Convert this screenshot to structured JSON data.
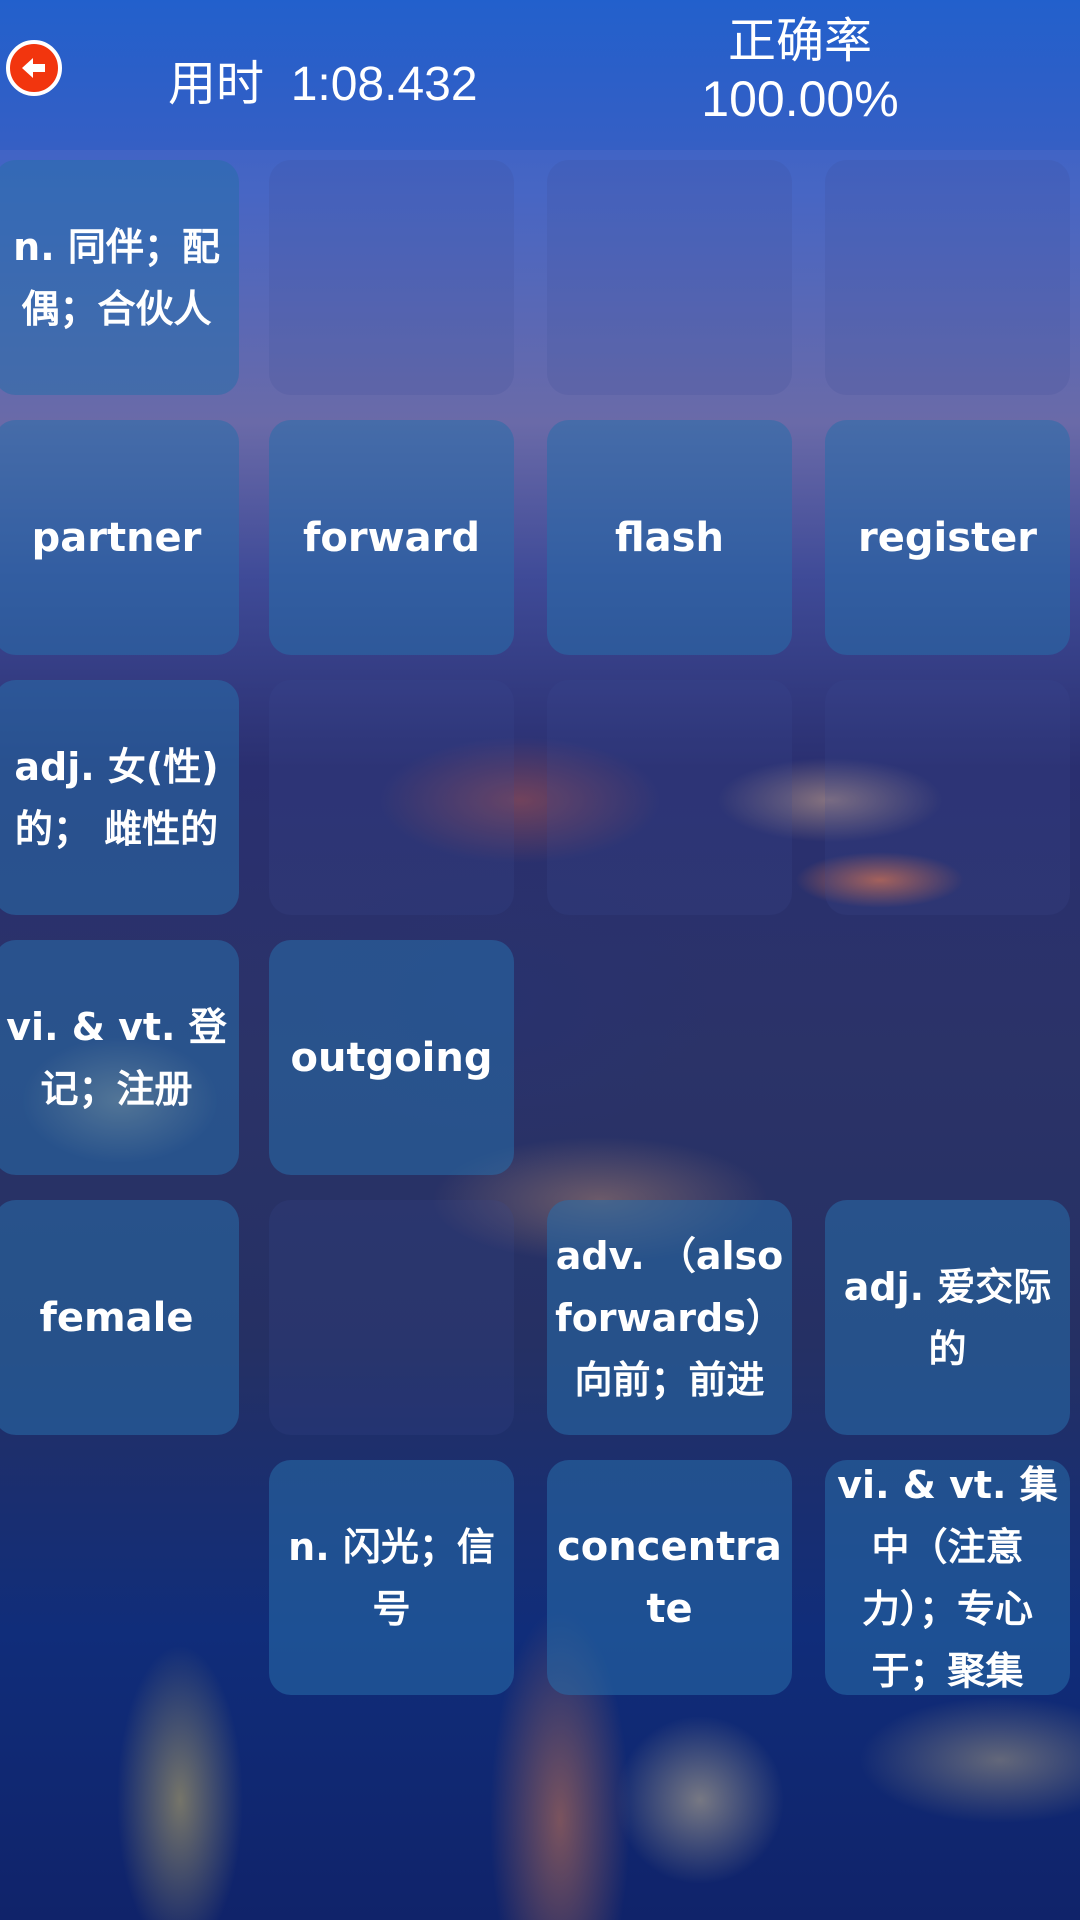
{
  "header": {
    "back_icon": "arrow-left-icon",
    "timer_label": "用时",
    "timer_value": "1:08.432",
    "accuracy_label": "正确率",
    "accuracy_value": "100.00%"
  },
  "tiles": [
    {
      "text": "n. 同伴；配偶；合伙人",
      "state": "filled"
    },
    {
      "text": "",
      "state": "empty"
    },
    {
      "text": "",
      "state": "empty"
    },
    {
      "text": "",
      "state": "empty"
    },
    {
      "text": "partner",
      "state": "filled"
    },
    {
      "text": "forward",
      "state": "filled"
    },
    {
      "text": "flash",
      "state": "filled"
    },
    {
      "text": "register",
      "state": "filled"
    },
    {
      "text": "adj. 女(性)的； 雌性的",
      "state": "filled"
    },
    {
      "text": "",
      "state": "empty"
    },
    {
      "text": "",
      "state": "empty"
    },
    {
      "text": "",
      "state": "empty"
    },
    {
      "text": "vi. & vt. 登记；注册",
      "state": "filled"
    },
    {
      "text": "outgoing",
      "state": "filled"
    },
    {
      "text": "",
      "state": "none"
    },
    {
      "text": "",
      "state": "none"
    },
    {
      "text": "female",
      "state": "filled"
    },
    {
      "text": "",
      "state": "empty"
    },
    {
      "text": "adv. （also forwards）向前；前进",
      "state": "filled"
    },
    {
      "text": "adj. 爱交际的",
      "state": "filled"
    },
    {
      "text": "",
      "state": "none"
    },
    {
      "text": "n. 闪光；信号",
      "state": "filled"
    },
    {
      "text": "concentrate",
      "state": "filled"
    },
    {
      "text": "vi. & vt. 集中（注意力）；专心于；聚集",
      "state": "filled"
    }
  ]
}
